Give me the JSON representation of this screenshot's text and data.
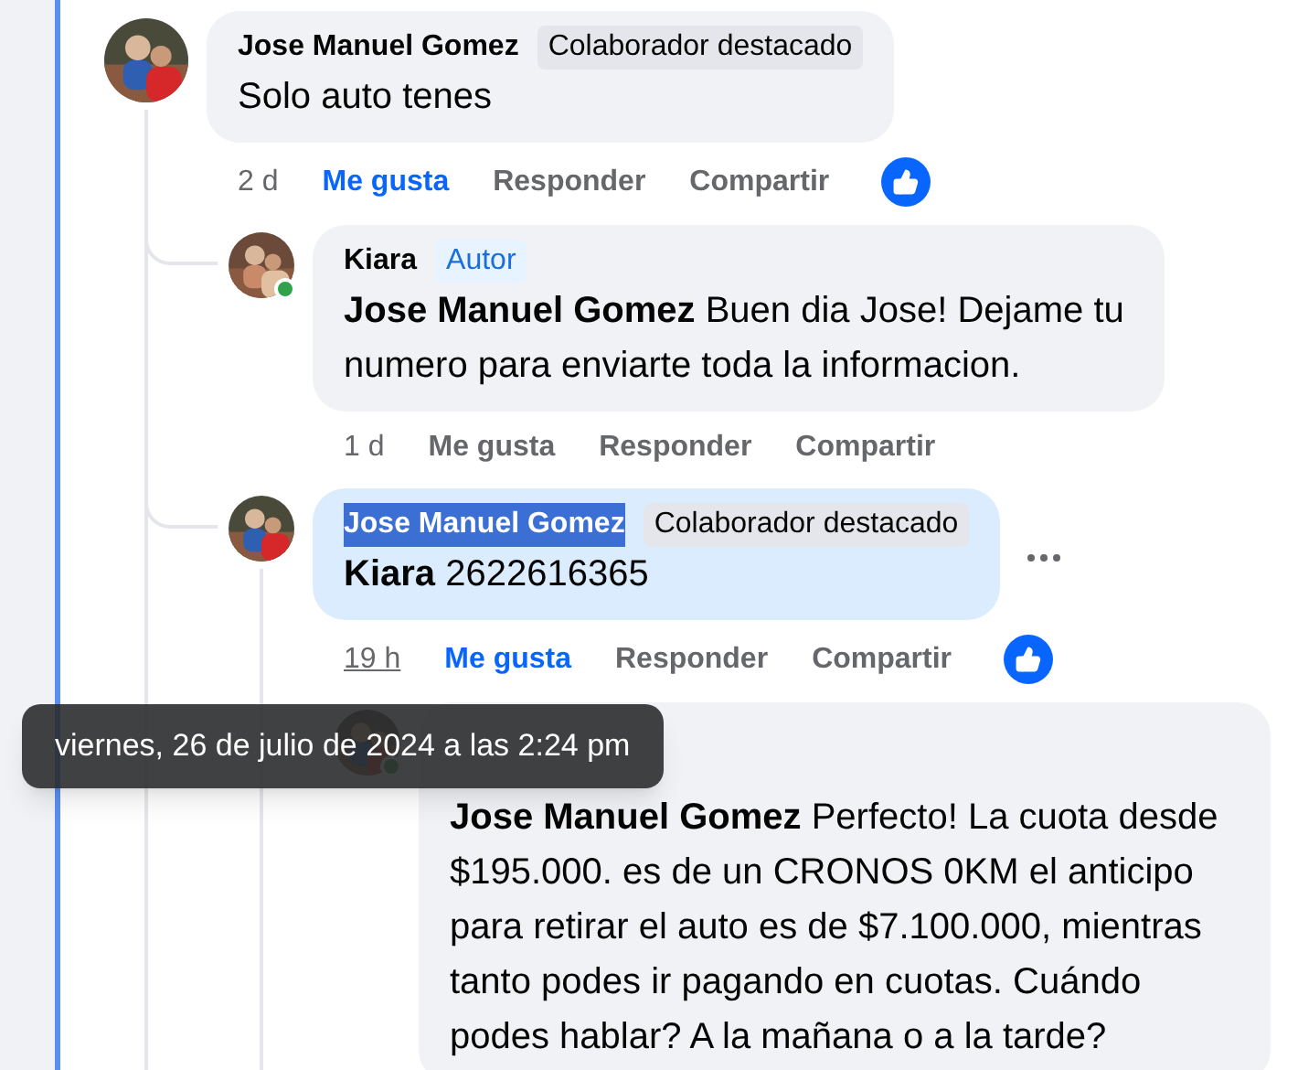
{
  "comments": [
    {
      "author": "Jose Manuel Gomez",
      "name_selected": false,
      "badge": {
        "kind": "top_fan",
        "text": "Colaborador destacado"
      },
      "online": false,
      "highlighted": false,
      "text": "Solo auto tenes",
      "time": "2 d",
      "time_hovered": false,
      "liked": true,
      "actions": [
        "Me gusta",
        "Responder",
        "Compartir"
      ],
      "reaction": true,
      "menu": false,
      "children": [
        {
          "author": "Kiara",
          "name_selected": false,
          "badge": {
            "kind": "author",
            "text": "Autor"
          },
          "online": true,
          "highlighted": false,
          "mention": "Jose Manuel Gomez",
          "text": "Buen dia Jose! Dejame tu numero para enviarte toda la informacion.",
          "time": "1 d",
          "time_hovered": false,
          "liked": false,
          "actions": [
            "Me gusta",
            "Responder",
            "Compartir"
          ],
          "reaction": false,
          "menu": false
        },
        {
          "author": "Jose Manuel Gomez",
          "name_selected": true,
          "badge": {
            "kind": "top_fan",
            "text": "Colaborador destacado"
          },
          "online": false,
          "highlighted": true,
          "mention": "Kiara",
          "text": "2622616365",
          "time": "19 h",
          "time_hovered": true,
          "liked": true,
          "actions": [
            "Me gusta",
            "Responder",
            "Compartir"
          ],
          "reaction": true,
          "menu": true,
          "children": [
            {
              "online": true,
              "highlighted": false,
              "mention": "Jose Manuel Gomez",
              "text": "Perfecto! La cuota desde $195.000. es de un CRONOS 0KM el anticipo para retirar el auto es de $7.100.000, mientras tanto podes ir pagando en cuotas. Cuándo podes hablar? A la mañana o a la tarde?",
              "reaction": false,
              "menu": false
            }
          ]
        }
      ]
    }
  ],
  "tooltip": {
    "text": "viernes, 26 de julio de 2024 a las 2:24 pm"
  }
}
